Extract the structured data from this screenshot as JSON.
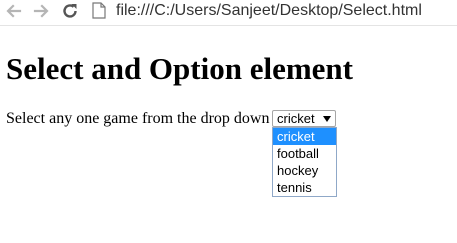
{
  "browser": {
    "address_bar": {
      "url": "file:///C:/Users/Sanjeet/Desktop/Select.html"
    },
    "icons": {
      "back": "back-arrow-icon",
      "forward": "forward-arrow-icon",
      "reload": "reload-icon",
      "page": "page-icon"
    }
  },
  "page": {
    "title": "Select and Option element",
    "prompt": "Select any one game from the drop down",
    "select": {
      "selected_value": "cricket",
      "options": [
        "cricket",
        "football",
        "hockey",
        "tennis"
      ],
      "highlighted_index": 0
    }
  },
  "colors": {
    "highlight": "#1e90ff",
    "highlight_text": "#ffffff",
    "dropdown_border": "#8fa8c8"
  }
}
